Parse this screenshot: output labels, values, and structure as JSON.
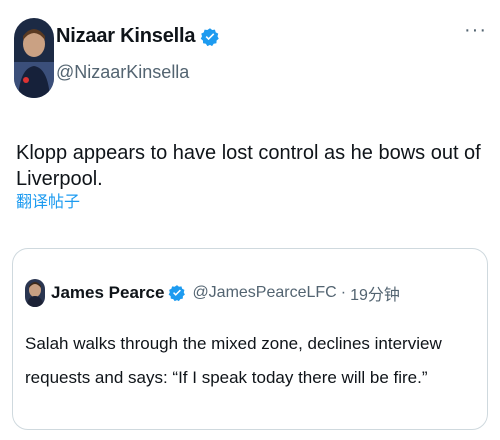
{
  "author": {
    "display_name": "Nizaar Kinsella",
    "handle": "@NizaarKinsella",
    "avatar_icon": "profile-photo",
    "verified_icon": "verified-badge-icon"
  },
  "more_label": "···",
  "tweet": {
    "text": "Klopp appears to have lost control as he bows out of Liverpool.",
    "translate_label": "翻译帖子"
  },
  "quote": {
    "display_name": "James Pearce",
    "handle": "@JamesPearceLFC",
    "separator": "·",
    "time": "19分钟",
    "text": "Salah walks through the mixed zone, declines interview requests and says: “If I speak today there will be fire.”"
  },
  "colors": {
    "accent": "#1d9bf0",
    "secondary_text": "#536471",
    "border": "#cfd9de"
  }
}
